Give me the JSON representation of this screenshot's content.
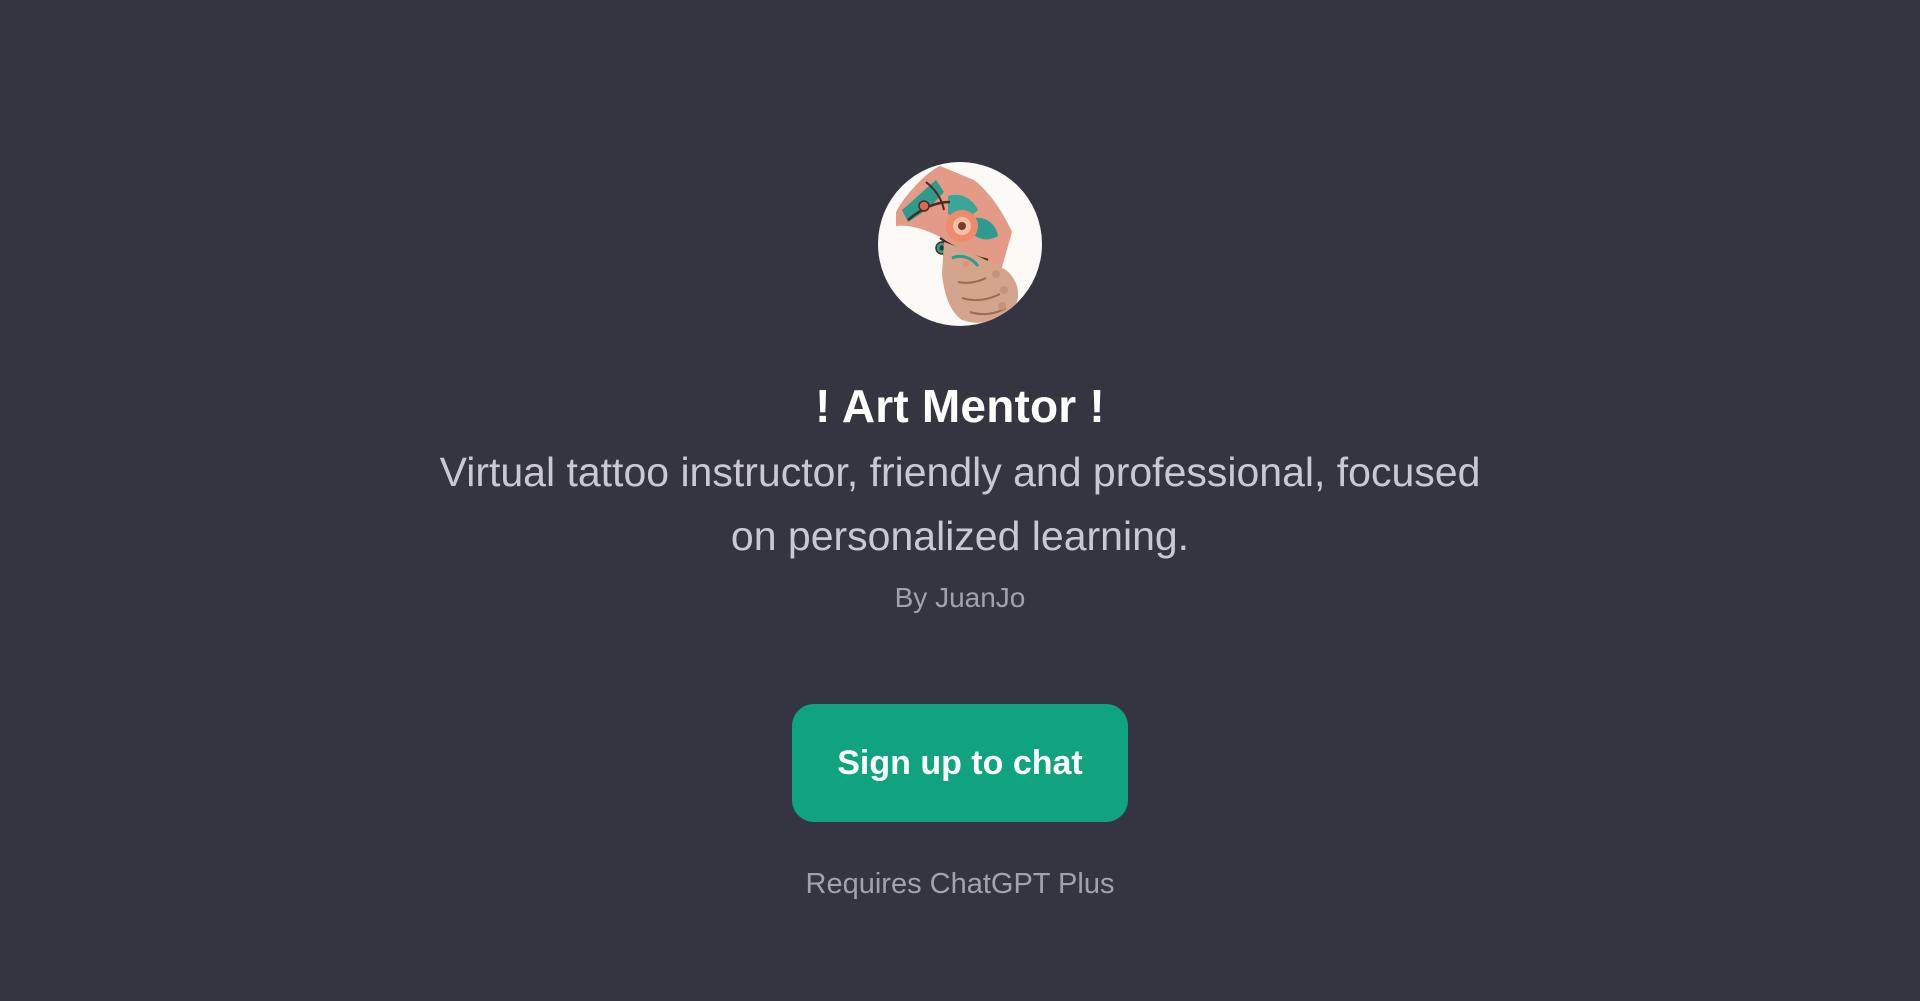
{
  "gpt": {
    "name": "! Art Mentor !",
    "description": "Virtual tattoo instructor, friendly and professional, focused on personalized learning.",
    "author": "By JuanJo",
    "avatar_icon": "tattooed-hand-avatar"
  },
  "actions": {
    "signup_label": "Sign up to chat"
  },
  "footer": {
    "requires_text": "Requires ChatGPT Plus"
  },
  "colors": {
    "background": "#343541",
    "accent": "#10a37f",
    "title": "#ffffff",
    "muted": "#a3a2ac"
  }
}
